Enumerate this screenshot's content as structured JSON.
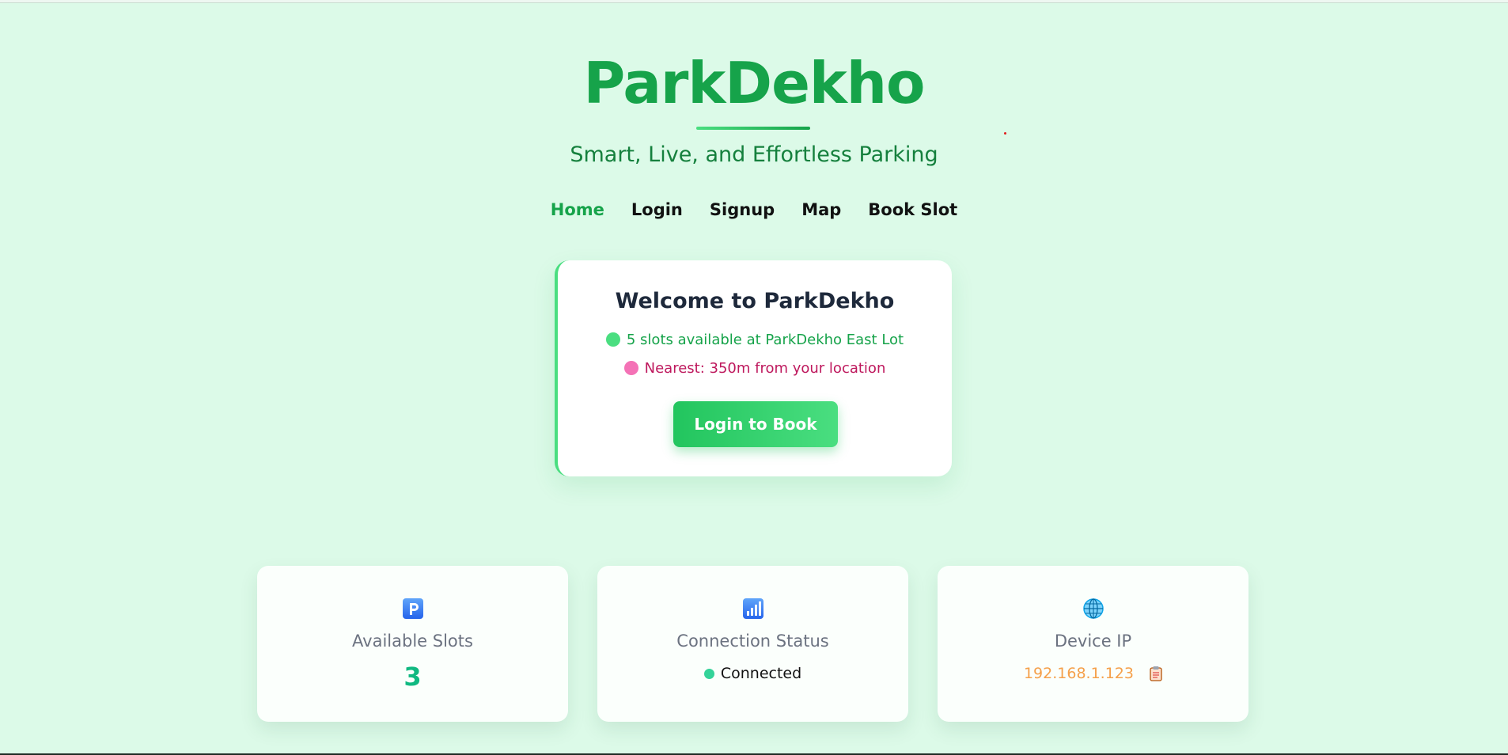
{
  "header": {
    "brand": "ParkDekho",
    "tagline": "Smart, Live, and Effortless Parking"
  },
  "nav": {
    "items": [
      {
        "label": "Home",
        "active": true
      },
      {
        "label": "Login",
        "active": false
      },
      {
        "label": "Signup",
        "active": false
      },
      {
        "label": "Map",
        "active": false
      },
      {
        "label": "Book Slot",
        "active": false
      }
    ]
  },
  "welcome": {
    "title": "Welcome to ParkDekho",
    "availability": "5 slots available at ParkDekho East Lot",
    "nearest": "Nearest: 350m from your location",
    "button_label": "Login to Book"
  },
  "stats": {
    "slots": {
      "icon": "parking-icon",
      "label": "Available Slots",
      "value": "3"
    },
    "connection": {
      "icon": "signal-bars-icon",
      "label": "Connection Status",
      "value": "Connected"
    },
    "device": {
      "icon": "globe-icon",
      "label": "Device IP",
      "value": "192.168.1.123",
      "copy_icon": "clipboard-icon"
    }
  },
  "colors": {
    "background": "#dcfae8",
    "brand": "#16a34a",
    "accent": "#4ade80",
    "nearest": "#be185d",
    "ip": "#f5a04a",
    "slots_value": "#10b981"
  }
}
